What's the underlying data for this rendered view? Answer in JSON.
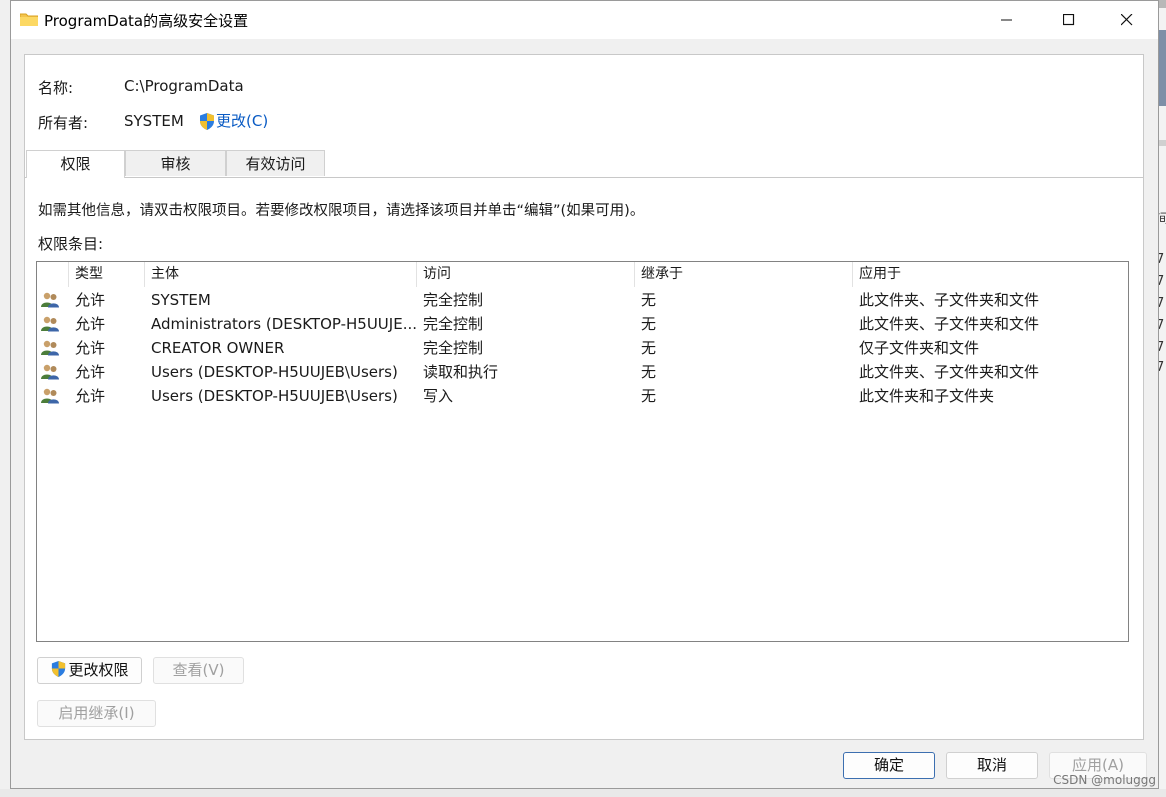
{
  "window": {
    "title": "ProgramData的高级安全设置"
  },
  "info": {
    "name_label": "名称:",
    "name_value": "C:\\ProgramData",
    "owner_label": "所有者:",
    "owner_value": "SYSTEM",
    "change_owner_link": "更改(C)"
  },
  "tabs": [
    "权限",
    "审核",
    "有效访问"
  ],
  "permissions": {
    "hint": "如需其他信息，请双击权限项目。若要修改权限项目，请选择该项目并单击“编辑”(如果可用)。",
    "entries_label": "权限条目:",
    "columns": [
      "类型",
      "主体",
      "访问",
      "继承于",
      "应用于"
    ],
    "rows": [
      {
        "type": "允许",
        "principal": "SYSTEM",
        "access": "完全控制",
        "inherited": "无",
        "applies": "此文件夹、子文件夹和文件"
      },
      {
        "type": "允许",
        "principal": "Administrators (DESKTOP-H5UUJE...",
        "access": "完全控制",
        "inherited": "无",
        "applies": "此文件夹、子文件夹和文件"
      },
      {
        "type": "允许",
        "principal": "CREATOR OWNER",
        "access": "完全控制",
        "inherited": "无",
        "applies": "仅子文件夹和文件"
      },
      {
        "type": "允许",
        "principal": "Users (DESKTOP-H5UUJEB\\Users)",
        "access": "读取和执行",
        "inherited": "无",
        "applies": "此文件夹、子文件夹和文件"
      },
      {
        "type": "允许",
        "principal": "Users (DESKTOP-H5UUJEB\\Users)",
        "access": "写入",
        "inherited": "无",
        "applies": "此文件夹和子文件夹"
      }
    ]
  },
  "buttons": {
    "change_permissions": "更改权限",
    "view": "查看(V)",
    "enable_inheritance": "启用继承(I)",
    "ok": "确定",
    "cancel": "取消",
    "apply": "应用(A)"
  },
  "watermark": "CSDN @moluggg",
  "background_right_digits": [
    "7",
    "7",
    "7",
    "7",
    "7",
    "7"
  ],
  "colors": {
    "link": "#0a5bc4",
    "primary_border": "#3c6fb0"
  }
}
